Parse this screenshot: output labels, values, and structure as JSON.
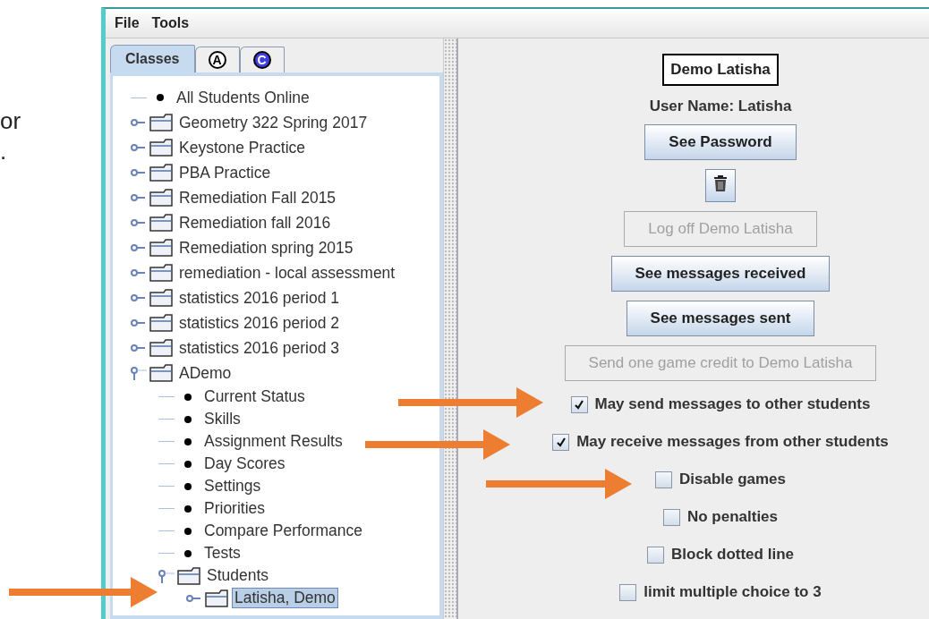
{
  "slide_text": [
    "or",
    "."
  ],
  "menu": [
    "File",
    "Tools"
  ],
  "tabs": [
    {
      "label": "Classes",
      "selected": true
    },
    {
      "label": "A",
      "selected": false,
      "color": "#ffffff"
    },
    {
      "label": "C",
      "selected": false,
      "color": "#4040e0"
    }
  ],
  "tree": [
    {
      "kind": "leaf",
      "label": "All Students Online",
      "selected": false
    },
    {
      "kind": "folder",
      "label": "Geometry 322 Spring 2017",
      "expanded": false,
      "selected": false
    },
    {
      "kind": "folder",
      "label": "Keystone Practice",
      "expanded": false,
      "selected": false
    },
    {
      "kind": "folder",
      "label": "PBA Practice",
      "expanded": false,
      "selected": false
    },
    {
      "kind": "folder",
      "label": "Remediation Fall 2015",
      "expanded": false,
      "selected": false
    },
    {
      "kind": "folder",
      "label": "Remediation fall 2016",
      "expanded": false,
      "selected": false
    },
    {
      "kind": "folder",
      "label": "Remediation spring 2015",
      "expanded": false,
      "selected": false
    },
    {
      "kind": "folder",
      "label": "remediation - local assessment",
      "expanded": false,
      "selected": false
    },
    {
      "kind": "folder",
      "label": "statistics 2016 period 1",
      "expanded": false,
      "selected": false
    },
    {
      "kind": "folder",
      "label": "statistics 2016 period 2",
      "expanded": false,
      "selected": false
    },
    {
      "kind": "folder",
      "label": "statistics 2016 period 3",
      "expanded": false,
      "selected": false
    },
    {
      "kind": "folder",
      "label": "ADemo",
      "expanded": true,
      "selected": false,
      "children": [
        {
          "kind": "leaf",
          "label": "Current Status",
          "selected": false
        },
        {
          "kind": "leaf",
          "label": "Skills",
          "selected": false
        },
        {
          "kind": "leaf",
          "label": "Assignment Results",
          "selected": false
        },
        {
          "kind": "leaf",
          "label": "Day Scores",
          "selected": false
        },
        {
          "kind": "leaf",
          "label": "Settings",
          "selected": false
        },
        {
          "kind": "leaf",
          "label": "Priorities",
          "selected": false
        },
        {
          "kind": "leaf",
          "label": "Compare Performance",
          "selected": false
        },
        {
          "kind": "leaf",
          "label": "Tests",
          "selected": false
        },
        {
          "kind": "folder",
          "label": "Students",
          "expanded": true,
          "selected": false,
          "children": [
            {
              "kind": "folder",
              "label": "Latisha, Demo",
              "expanded": false,
              "selected": true
            }
          ]
        }
      ]
    }
  ],
  "student": {
    "name": "Demo Latisha",
    "user_name": "User Name: Latisha"
  },
  "actions": [
    {
      "kind": "text",
      "label": "See Password",
      "disabled": false
    },
    {
      "kind": "trash",
      "disabled": false
    },
    {
      "kind": "text",
      "label": "Log off Demo Latisha",
      "disabled": true
    },
    {
      "kind": "text",
      "label": "See messages received",
      "disabled": false
    },
    {
      "kind": "text",
      "label": "See messages sent",
      "disabled": false
    },
    {
      "kind": "text",
      "label": "Send one game credit to Demo Latisha",
      "disabled": true
    }
  ],
  "options": [
    {
      "label": "May send messages to other students",
      "checked": true
    },
    {
      "label": "May receive messages from other students",
      "checked": true
    },
    {
      "label": "Disable games",
      "checked": false
    },
    {
      "label": "No penalties",
      "checked": false
    },
    {
      "label": "Block dotted line",
      "checked": false
    },
    {
      "label": "limit multiple choice to 3",
      "checked": false
    }
  ]
}
